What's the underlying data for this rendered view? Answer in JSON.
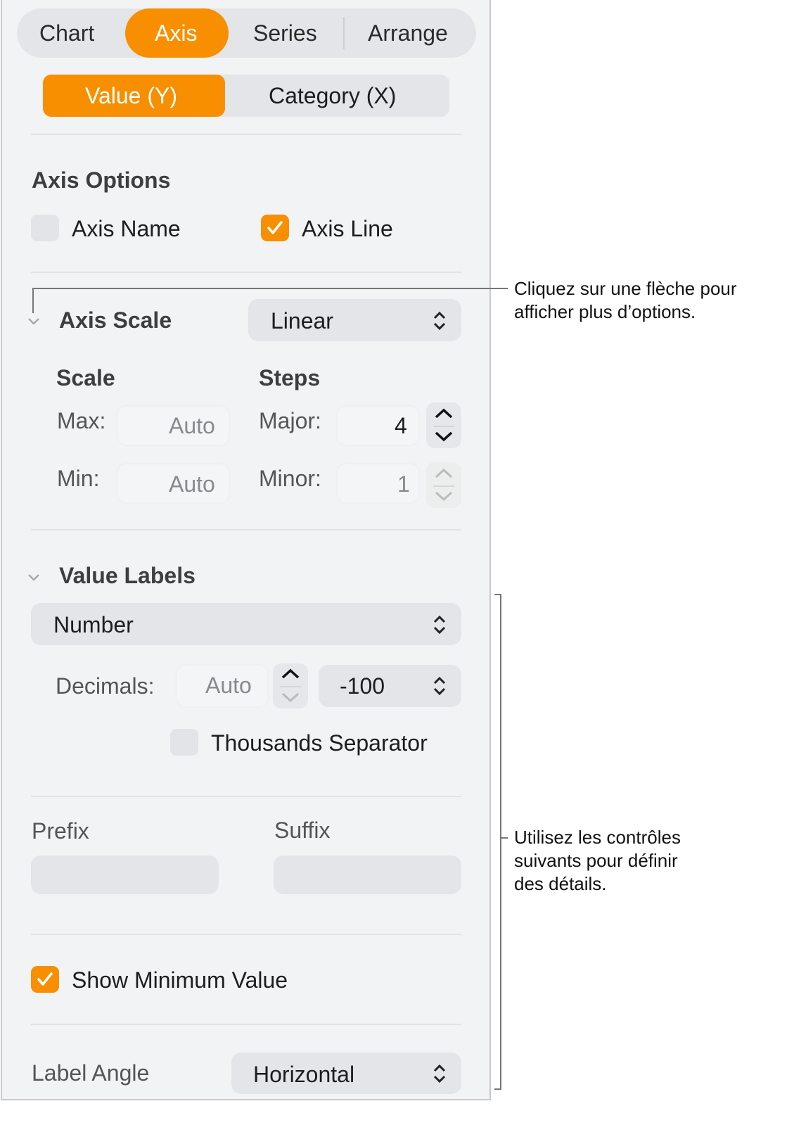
{
  "tabs": [
    {
      "label": "Chart",
      "selected": false
    },
    {
      "label": "Axis",
      "selected": true
    },
    {
      "label": "Series",
      "selected": false
    },
    {
      "label": "Arrange",
      "selected": false
    }
  ],
  "axis_segments": [
    {
      "label": "Value (Y)",
      "selected": true
    },
    {
      "label": "Category (X)",
      "selected": false
    }
  ],
  "axis_options": {
    "title": "Axis Options",
    "axis_name": {
      "label": "Axis Name",
      "checked": false
    },
    "axis_line": {
      "label": "Axis Line",
      "checked": true
    }
  },
  "axis_scale": {
    "title": "Axis Scale",
    "value": "Linear",
    "scale_title": "Scale",
    "steps_title": "Steps",
    "max_label": "Max:",
    "max_value": "Auto",
    "min_label": "Min:",
    "min_value": "Auto",
    "major_label": "Major:",
    "major_value": "4",
    "minor_label": "Minor:",
    "minor_value": "1"
  },
  "value_labels": {
    "title": "Value Labels",
    "format": "Number",
    "decimals_label": "Decimals:",
    "decimals_value": "Auto",
    "negative_format": "-100",
    "thousands": {
      "label": "Thousands Separator",
      "checked": false
    },
    "prefix_label": "Prefix",
    "prefix_value": "",
    "suffix_label": "Suffix",
    "suffix_value": "",
    "show_min": {
      "label": "Show Minimum Value",
      "checked": true
    },
    "label_angle_label": "Label Angle",
    "label_angle": "Horizontal"
  },
  "callouts": {
    "arrow": [
      "Cliquez sur une flèche pour",
      "afficher plus d’options."
    ],
    "details": [
      "Utilisez les contrôles",
      "suivants pour définir",
      "des détails."
    ]
  },
  "colors": {
    "accent": "#f78f00",
    "panel": "#f2f3f5"
  }
}
